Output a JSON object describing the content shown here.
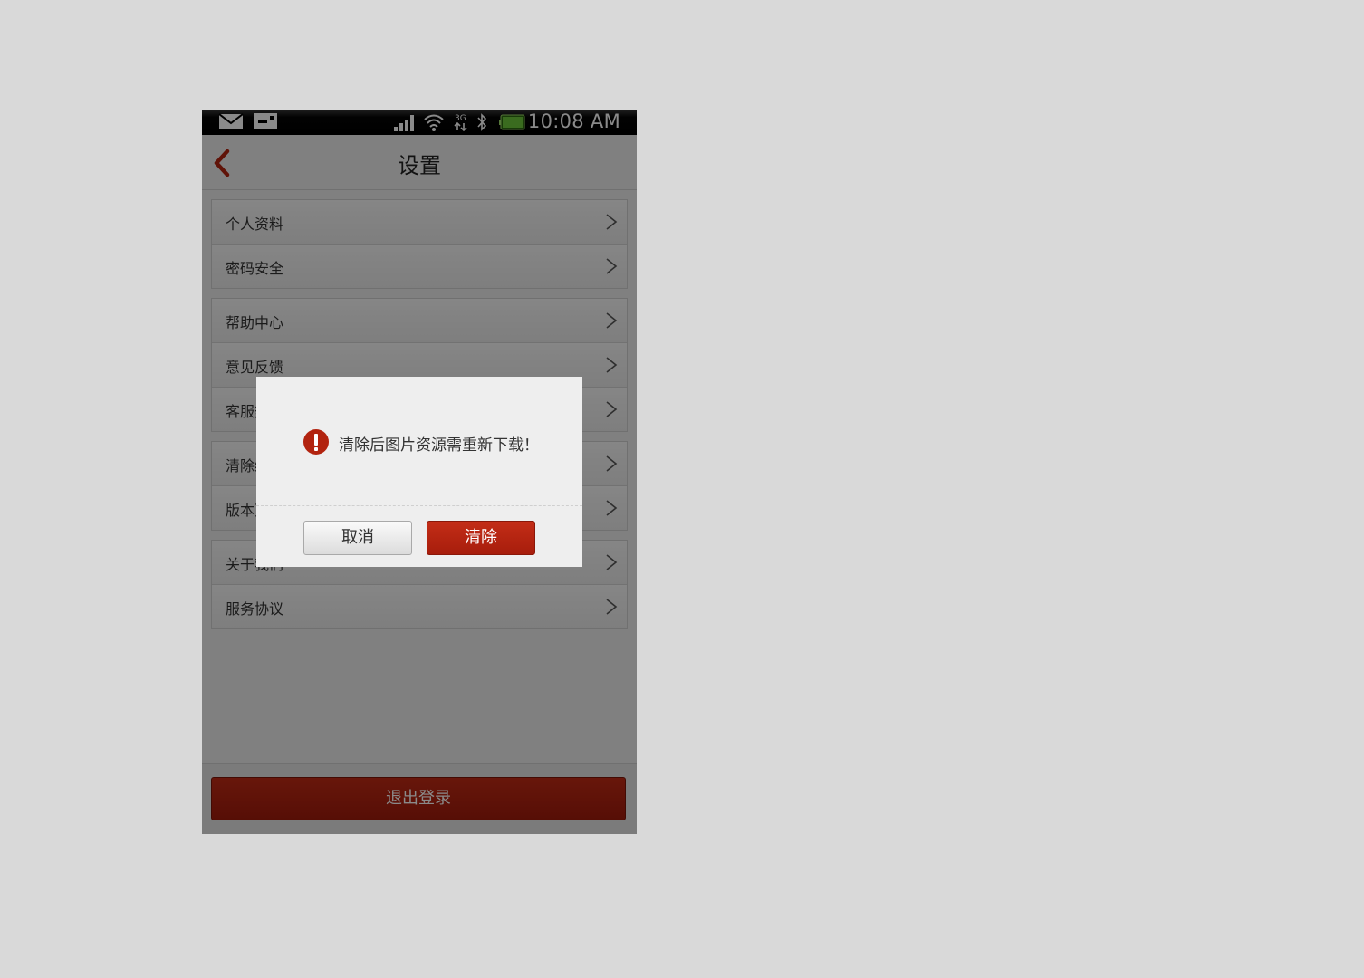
{
  "status_bar": {
    "time": "10:08 AM",
    "icons": [
      "mail-icon",
      "sim-icon",
      "signal-icon",
      "wifi-icon",
      "3g-icon",
      "bluetooth-icon",
      "battery-icon"
    ]
  },
  "header": {
    "title": "设置",
    "back_icon": "chevron-left-icon"
  },
  "groups": [
    {
      "items": [
        {
          "label": "个人资料"
        },
        {
          "label": "密码安全"
        }
      ]
    },
    {
      "items": [
        {
          "label": "帮助中心"
        },
        {
          "label": "意见反馈"
        },
        {
          "label": "客服热线"
        }
      ]
    },
    {
      "items": [
        {
          "label": "清除缓存"
        },
        {
          "label": "版本更新"
        }
      ]
    },
    {
      "items": [
        {
          "label": "关于我们"
        },
        {
          "label": "服务协议"
        }
      ]
    }
  ],
  "logout": {
    "label": "退出登录"
  },
  "dialog": {
    "message": "清除后图片资源需重新下载！",
    "icon": "alert-icon",
    "cancel_label": "取消",
    "confirm_label": "清除"
  },
  "colors": {
    "accent_red": "#b2230f",
    "background": "#ececec",
    "page_backdrop": "#d9d9d9",
    "overlay": "rgba(0,0,0,0.46)"
  }
}
